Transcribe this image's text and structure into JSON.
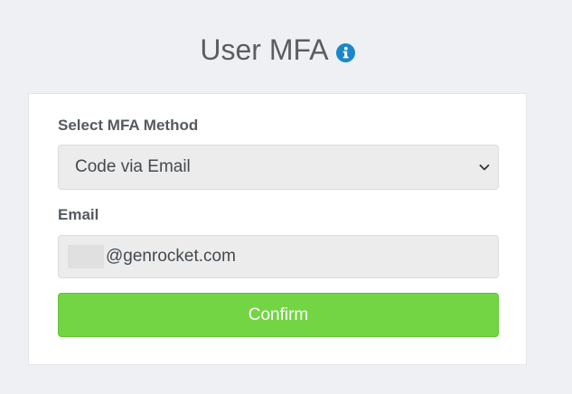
{
  "header": {
    "title": "User MFA",
    "info_icon": "info-circle-icon"
  },
  "form": {
    "method_label": "Select MFA Method",
    "method_selected": "Code via Email",
    "method_dropdown_icon": "chevron-down-icon",
    "email_label": "Email",
    "email_value": "@genrocket.com",
    "confirm_label": "Confirm"
  },
  "colors": {
    "background": "#eef0f4",
    "card": "#ffffff",
    "confirm_button": "#73d444",
    "info_icon": "#1a87cc",
    "field_background": "#ececec"
  }
}
